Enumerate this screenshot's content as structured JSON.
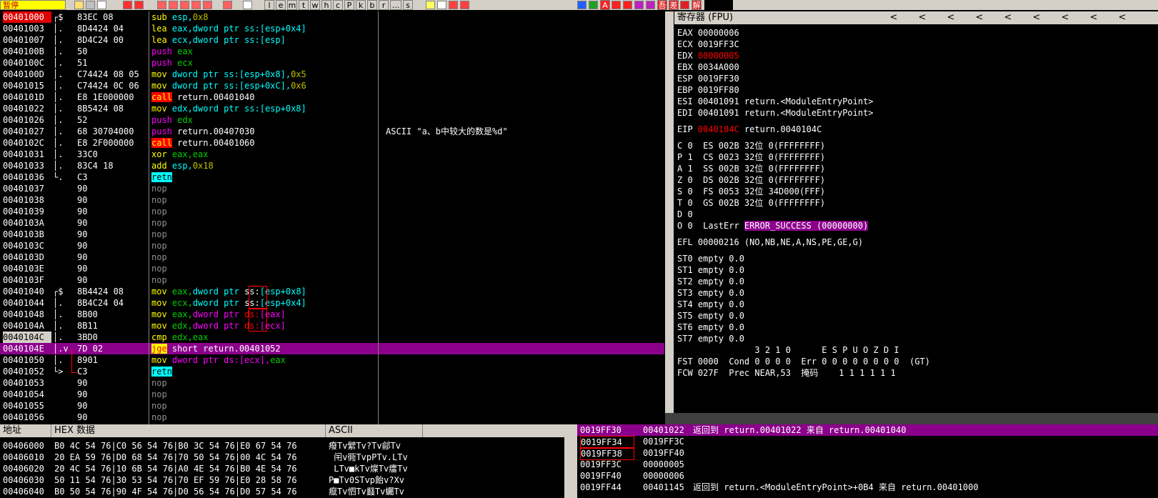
{
  "toolbar": {
    "status": "暂停",
    "letters": [
      "l",
      "e",
      "m",
      "t",
      "w",
      "h",
      "c",
      "P",
      "k",
      "b",
      "r",
      "...",
      "s"
    ],
    "right_labels": [
      "A",
      "吾",
      "差",
      "解"
    ]
  },
  "cpu": {
    "rows": [
      {
        "addr": "00401000",
        "mark": "┌$",
        "hex": "83EC 08",
        "dis": [
          [
            "sub",
            "y"
          ],
          [
            " esp,",
            "c"
          ],
          [
            "0x8",
            "o"
          ]
        ],
        "addr_style": "red"
      },
      {
        "addr": "00401003",
        "mark": "│.",
        "hex": "8D4424 04",
        "dis": [
          [
            "lea",
            "y"
          ],
          [
            " eax,dword ptr ss:[esp+0x4]",
            "c"
          ]
        ]
      },
      {
        "addr": "00401007",
        "mark": "│.",
        "hex": "8D4C24 00",
        "dis": [
          [
            "lea",
            "y"
          ],
          [
            " ecx,dword ptr ss:[esp]",
            "c"
          ]
        ]
      },
      {
        "addr": "0040100B",
        "mark": "│.",
        "hex": "50",
        "dis": [
          [
            "push",
            "m"
          ],
          [
            " eax",
            "g"
          ]
        ]
      },
      {
        "addr": "0040100C",
        "mark": "│.",
        "hex": "51",
        "dis": [
          [
            "push",
            "m"
          ],
          [
            " ecx",
            "g"
          ]
        ]
      },
      {
        "addr": "0040100D",
        "mark": "│.",
        "hex": "C74424 08 05",
        "dis": [
          [
            "mov",
            "y"
          ],
          [
            " dword ptr ss:[esp+0x8],",
            "c"
          ],
          [
            "0x5",
            "o"
          ]
        ]
      },
      {
        "addr": "00401015",
        "mark": "│.",
        "hex": "C74424 0C 06",
        "dis": [
          [
            "mov",
            "y"
          ],
          [
            " dword ptr ss:[esp+0xC],",
            "c"
          ],
          [
            "0x6",
            "o"
          ]
        ]
      },
      {
        "addr": "0040101D",
        "mark": "│.",
        "hex": "E8 1E000000",
        "dis": [
          [
            "call",
            "call"
          ],
          [
            " return.00401040",
            "w"
          ]
        ]
      },
      {
        "addr": "00401022",
        "mark": "│.",
        "hex": "8B5424 08",
        "dis": [
          [
            "mov",
            "y"
          ],
          [
            " edx,dword ptr ss:[esp+0x8]",
            "c"
          ]
        ]
      },
      {
        "addr": "00401026",
        "mark": "│.",
        "hex": "52",
        "dis": [
          [
            "push",
            "m"
          ],
          [
            " edx",
            "g"
          ]
        ]
      },
      {
        "addr": "00401027",
        "mark": "│.",
        "hex": "68 30704000",
        "dis": [
          [
            "push",
            "m"
          ],
          [
            " return.00407030",
            "w"
          ]
        ],
        "comment": "ASCII \"a、b中较大的数是%d\""
      },
      {
        "addr": "0040102C",
        "mark": "│.",
        "hex": "E8 2F000000",
        "dis": [
          [
            "call",
            "call"
          ],
          [
            " return.00401060",
            "w"
          ]
        ]
      },
      {
        "addr": "00401031",
        "mark": "│.",
        "hex": "33C0",
        "dis": [
          [
            "xor",
            "y"
          ],
          [
            " eax,eax",
            "g"
          ]
        ]
      },
      {
        "addr": "00401033",
        "mark": "│.",
        "hex": "83C4 18",
        "dis": [
          [
            "add",
            "y"
          ],
          [
            " esp,",
            "c"
          ],
          [
            "0x18",
            "o"
          ]
        ]
      },
      {
        "addr": "00401036",
        "mark": "└.",
        "hex": "C3",
        "dis": [
          [
            "retn",
            "ret"
          ]
        ]
      },
      {
        "addr": "00401037",
        "mark": "",
        "hex": "90",
        "dis": [
          [
            "nop",
            "grey"
          ]
        ]
      },
      {
        "addr": "00401038",
        "mark": "",
        "hex": "90",
        "dis": [
          [
            "nop",
            "grey"
          ]
        ]
      },
      {
        "addr": "00401039",
        "mark": "",
        "hex": "90",
        "dis": [
          [
            "nop",
            "grey"
          ]
        ]
      },
      {
        "addr": "0040103A",
        "mark": "",
        "hex": "90",
        "dis": [
          [
            "nop",
            "grey"
          ]
        ]
      },
      {
        "addr": "0040103B",
        "mark": "",
        "hex": "90",
        "dis": [
          [
            "nop",
            "grey"
          ]
        ]
      },
      {
        "addr": "0040103C",
        "mark": "",
        "hex": "90",
        "dis": [
          [
            "nop",
            "grey"
          ]
        ]
      },
      {
        "addr": "0040103D",
        "mark": "",
        "hex": "90",
        "dis": [
          [
            "nop",
            "grey"
          ]
        ]
      },
      {
        "addr": "0040103E",
        "mark": "",
        "hex": "90",
        "dis": [
          [
            "nop",
            "grey"
          ]
        ]
      },
      {
        "addr": "0040103F",
        "mark": "",
        "hex": "90",
        "dis": [
          [
            "nop",
            "grey"
          ]
        ]
      },
      {
        "addr": "00401040",
        "mark": "┌$",
        "hex": "8B4424 08",
        "dis": [
          [
            "mov",
            "y"
          ],
          [
            " eax,",
            "g"
          ],
          [
            "dword ptr ",
            "c"
          ],
          [
            "ss:",
            "w"
          ],
          [
            "[esp+0x8]",
            "c"
          ]
        ]
      },
      {
        "addr": "00401044",
        "mark": "│.",
        "hex": "8B4C24 04",
        "dis": [
          [
            "mov",
            "y"
          ],
          [
            " ecx,",
            "g"
          ],
          [
            "dword ptr ",
            "c"
          ],
          [
            "ss:",
            "w"
          ],
          [
            "[esp+0x4]",
            "c"
          ]
        ]
      },
      {
        "addr": "00401048",
        "mark": "│.",
        "hex": "8B00",
        "dis": [
          [
            "mov",
            "y"
          ],
          [
            " eax,",
            "g"
          ],
          [
            "dword ptr ",
            "m"
          ],
          [
            "ds:",
            "r"
          ],
          [
            "[eax]",
            "m"
          ]
        ]
      },
      {
        "addr": "0040104A",
        "mark": "│.",
        "hex": "8B11",
        "dis": [
          [
            "mov",
            "y"
          ],
          [
            " edx,",
            "g"
          ],
          [
            "dword ptr ",
            "m"
          ],
          [
            "ds:",
            "r"
          ],
          [
            "[ecx]",
            "m"
          ]
        ]
      },
      {
        "addr": "0040104C",
        "mark": "│.",
        "hex": "3BD0",
        "dis": [
          [
            "cmp",
            "y"
          ],
          [
            " edx,eax",
            "g"
          ]
        ],
        "addr_style": "cur"
      },
      {
        "addr": "0040104E",
        "mark": "│.v",
        "hex": "7D 02",
        "dis": [
          [
            "jge",
            "jge"
          ],
          [
            " short return.00401052",
            "w"
          ]
        ],
        "highlight": true
      },
      {
        "addr": "00401050",
        "mark": "│.",
        "hex": "8901",
        "dis": [
          [
            "mov",
            "y"
          ],
          [
            " dword ptr ds:[ecx],",
            "m"
          ],
          [
            "eax",
            "g"
          ]
        ]
      },
      {
        "addr": "00401052",
        "mark": "└>",
        "hex": "C3",
        "dis": [
          [
            "retn",
            "ret"
          ]
        ]
      },
      {
        "addr": "00401053",
        "mark": "",
        "hex": "90",
        "dis": [
          [
            "nop",
            "grey"
          ]
        ]
      },
      {
        "addr": "00401054",
        "mark": "",
        "hex": "90",
        "dis": [
          [
            "nop",
            "grey"
          ]
        ]
      },
      {
        "addr": "00401055",
        "mark": "",
        "hex": "90",
        "dis": [
          [
            "nop",
            "grey"
          ]
        ]
      },
      {
        "addr": "00401056",
        "mark": "",
        "hex": "90",
        "dis": [
          [
            "nop",
            "grey"
          ]
        ]
      }
    ]
  },
  "registers": {
    "title": "寄存器 (FPU)",
    "arrow": "<",
    "lines": [
      {
        "text": "EAX 00000006",
        "gap": false
      },
      {
        "text": "ECX 0019FF3C",
        "gap": false
      },
      {
        "pre": "EDX ",
        "red": "00000005",
        "post": "",
        "gap": false
      },
      {
        "text": "EBX 0034A000",
        "gap": false
      },
      {
        "text": "ESP 0019FF30",
        "gap": false
      },
      {
        "text": "EBP 0019FF80",
        "gap": false
      },
      {
        "text": "ESI 00401091 return.<ModuleEntryPoint>",
        "gap": false
      },
      {
        "text": "EDI 00401091 return.<ModuleEntryPoint>",
        "gap": false
      },
      {
        "pre": "EIP ",
        "red": "0040104C",
        "post": " return.0040104C",
        "gap": true
      },
      {
        "text": "C 0  ES 002B 32位 0(FFFFFFFF)",
        "gap": true
      },
      {
        "text": "P 1  CS 0023 32位 0(FFFFFFFF)",
        "gap": false
      },
      {
        "text": "A 1  SS 002B 32位 0(FFFFFFFF)",
        "gap": false
      },
      {
        "text": "Z 0  DS 002B 32位 0(FFFFFFFF)",
        "gap": false
      },
      {
        "text": "S 0  FS 0053 32位 34D000(FFF)",
        "gap": false
      },
      {
        "text": "T 0  GS 002B 32位 0(FFFFFFFF)",
        "gap": false
      },
      {
        "text": "D 0",
        "gap": false
      },
      {
        "pre": "O 0  LastErr ",
        "err": "ERROR_SUCCESS (00000000)",
        "gap": false
      },
      {
        "text": "EFL 00000216 (NO,NB,NE,A,NS,PE,GE,G)",
        "gap": true
      },
      {
        "text": "ST0 empty 0.0",
        "gap": true
      },
      {
        "text": "ST1 empty 0.0",
        "gap": false
      },
      {
        "text": "ST2 empty 0.0",
        "gap": false
      },
      {
        "text": "ST3 empty 0.0",
        "gap": false
      },
      {
        "text": "ST4 empty 0.0",
        "gap": false
      },
      {
        "text": "ST5 empty 0.0",
        "gap": false
      },
      {
        "text": "ST6 empty 0.0",
        "gap": false
      },
      {
        "text": "ST7 empty 0.0",
        "gap": false
      },
      {
        "text": "               3 2 1 0      E S P U O Z D I",
        "gap": false
      },
      {
        "text": "FST 0000  Cond 0 0 0 0  Err 0 0 0 0 0 0 0 0  (GT)",
        "gap": false
      },
      {
        "text": "FCW 027F  Prec NEAR,53  掩码    1 1 1 1 1 1",
        "gap": false
      }
    ]
  },
  "dump": {
    "headers": [
      "地址",
      "HEX 数据",
      "ASCII"
    ],
    "rows": [
      {
        "addr": "00406000",
        "hex": "B0 4C 54 76|C0 56 54 76|B0 3C 54 76|E0 67 54 76",
        "ascii": "癈Tv繴Tv?Tv鄃Tv"
      },
      {
        "addr": "00406010",
        "hex": "20 EA 59 76|D0 68 54 76|70 50 54 76|00 4C 54 76",
        "ascii": " 闬v衕TvpPTv.LTv"
      },
      {
        "addr": "00406020",
        "hex": "20 4C 54 76|10 6B 54 76|A0 4E 54 76|B0 4E 54 76",
        "ascii": " LTv■kTv燦Tv癗Tv"
      },
      {
        "addr": "00406030",
        "hex": "50 11 54 76|30 53 54 76|70 EF 59 76|E0 28 58 76",
        "ascii": "P■Tv0STvp飴v?Xv"
      },
      {
        "addr": "00406040",
        "hex": "B0 50 54 76|90 4F 54 76|D0 56 54 76|D0 57 54 76",
        "ascii": "癙Tv怬Tv蠽Tv蠾Tv"
      }
    ]
  },
  "stack": {
    "rows": [
      {
        "addr": "0019FF30",
        "val": "00401022",
        "comment": "返回到 return.00401022 来自 return.00401040",
        "highlight": true
      },
      {
        "addr": "0019FF34",
        "val": "0019FF3C",
        "comment": "",
        "sel": true
      },
      {
        "addr": "0019FF38",
        "val": "0019FF40",
        "comment": "",
        "sel": true
      },
      {
        "addr": "0019FF3C",
        "val": "00000005",
        "comment": ""
      },
      {
        "addr": "0019FF40",
        "val": "00000006",
        "comment": ""
      },
      {
        "addr": "0019FF44",
        "val": "00401145",
        "comment": "返回到 return.<ModuleEntryPoint>+0B4 来自 return.00401000"
      }
    ]
  }
}
